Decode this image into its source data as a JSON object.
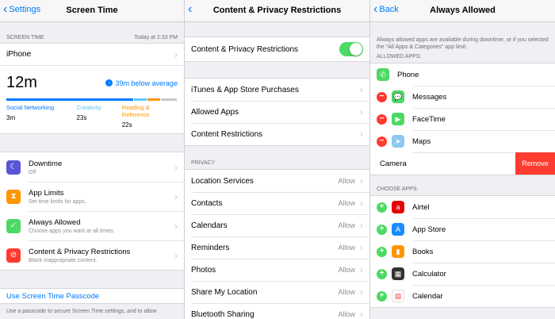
{
  "panel1": {
    "back_label": "Settings",
    "title": "Screen Time",
    "section_label": "SCREEN TIME",
    "timestamp": "Today at 2:33 PM",
    "device": "iPhone",
    "total_time": "12m",
    "below_average": "39m below average",
    "categories": [
      {
        "name": "Social Networking",
        "time": "3m",
        "color": "#007aff"
      },
      {
        "name": "Creativity",
        "time": "23s",
        "color": "#5ac8fa"
      },
      {
        "name": "Reading & Reference",
        "time": "22s",
        "color": "#ff9500"
      }
    ],
    "menu": [
      {
        "title": "Downtime",
        "subtitle": "Off",
        "icon": "moon-icon",
        "color": "#5856d6"
      },
      {
        "title": "App Limits",
        "subtitle": "Set time limits for apps.",
        "icon": "hourglass-icon",
        "color": "#ff9500"
      },
      {
        "title": "Always Allowed",
        "subtitle": "Choose apps you want at all times.",
        "icon": "checkmark-icon",
        "color": "#4cd964"
      },
      {
        "title": "Content & Privacy Restrictions",
        "subtitle": "Block inappropriate content.",
        "icon": "restriction-icon",
        "color": "#ff3b30"
      }
    ],
    "passcode_link": "Use Screen Time Passcode",
    "passcode_footer": "Use a passcode to secure Screen Time settings, and to allow"
  },
  "panel2": {
    "title": "Content & Privacy Restrictions",
    "toggle_label": "Content & Privacy Restrictions",
    "toggle_on": true,
    "store_items": [
      "iTunes & App Store Purchases",
      "Allowed Apps",
      "Content Restrictions"
    ],
    "privacy_header": "PRIVACY",
    "privacy_items": [
      {
        "label": "Location Services",
        "value": "Allow"
      },
      {
        "label": "Contacts",
        "value": "Allow"
      },
      {
        "label": "Calendars",
        "value": "Allow"
      },
      {
        "label": "Reminders",
        "value": "Allow"
      },
      {
        "label": "Photos",
        "value": "Allow"
      },
      {
        "label": "Share My Location",
        "value": "Allow"
      },
      {
        "label": "Bluetooth Sharing",
        "value": "Allow"
      }
    ]
  },
  "panel3": {
    "back_label": "Back",
    "title": "Always Allowed",
    "note": "Always allowed apps are available during downtime, or if you selected the \"All Apps & Categories\" app limit.",
    "allowed_header": "ALLOWED APPS:",
    "allowed_apps": [
      {
        "name": "Phone",
        "icon": "phone-icon",
        "color": "#4cd964"
      },
      {
        "name": "Messages",
        "icon": "messages-icon",
        "color": "#4cd964"
      },
      {
        "name": "FaceTime",
        "icon": "facetime-icon",
        "color": "#4cd964"
      },
      {
        "name": "Maps",
        "icon": "maps-icon",
        "color": "#8fc8f0"
      }
    ],
    "camera_label": "Camera",
    "remove_label": "Remove",
    "choose_header": "CHOOSE APPS:",
    "choose_apps": [
      {
        "name": "Airtel",
        "icon": "airtel-icon",
        "color": "#e40000"
      },
      {
        "name": "App Store",
        "icon": "app-store-icon",
        "color": "#1a8cff"
      },
      {
        "name": "Books",
        "icon": "books-icon",
        "color": "#ff9500"
      },
      {
        "name": "Calculator",
        "icon": "calculator-icon",
        "color": "#333333"
      },
      {
        "name": "Calendar",
        "icon": "calendar-icon",
        "color": "#ffffff"
      }
    ]
  }
}
